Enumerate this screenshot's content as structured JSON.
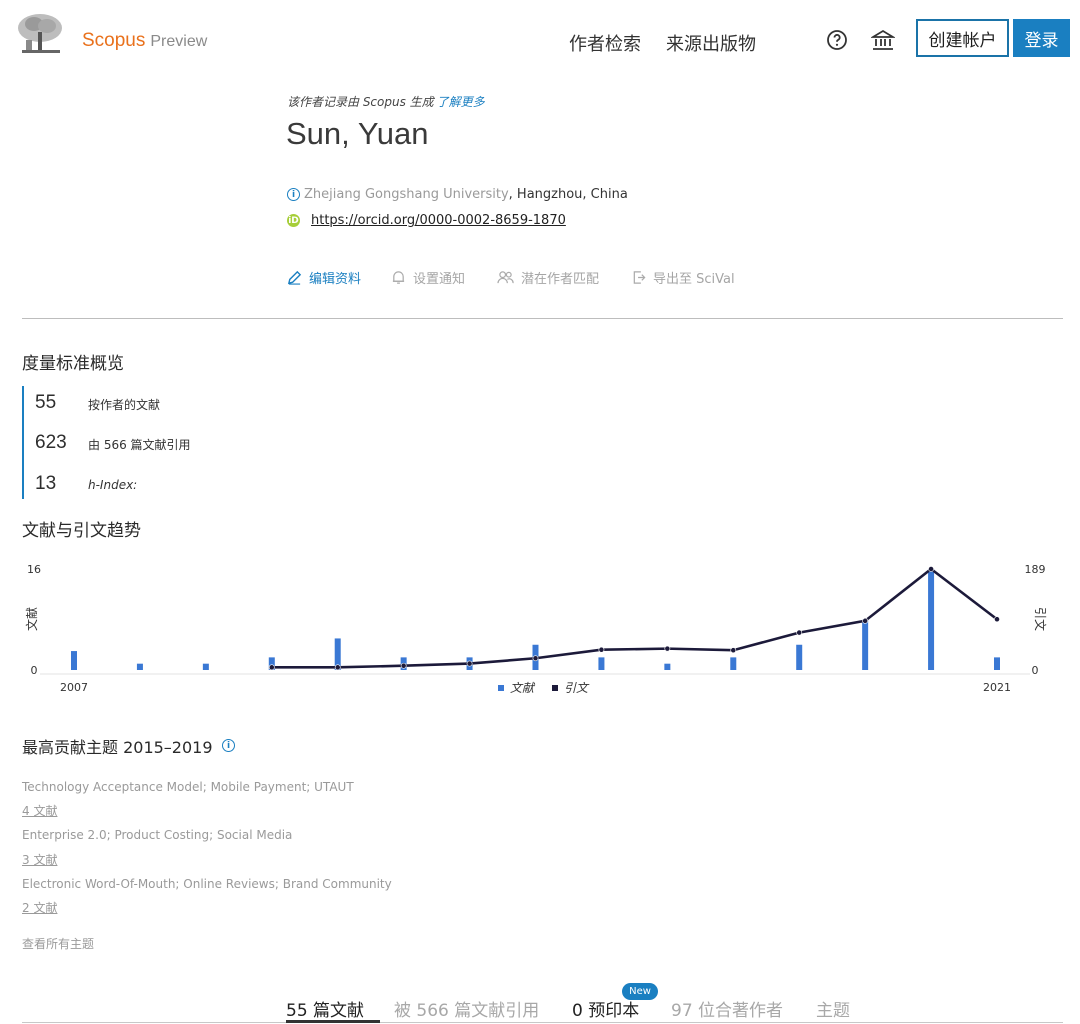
{
  "header": {
    "brand": "Scopus",
    "brand_suffix": "Preview",
    "nav": [
      "作者检索",
      "来源出版物"
    ],
    "create_account": "创建帐户",
    "login": "登录"
  },
  "profile": {
    "generated_note": "该作者记录由 Scopus 生成",
    "learn_more": "了解更多",
    "name": "Sun, Yuan",
    "affiliation": "Zhejiang Gongshang University",
    "location": ", Hangzhou, China",
    "orcid": "https://orcid.org/0000-0002-8659-1870",
    "actions": [
      "编辑资料",
      "设置通知",
      "潜在作者匹配",
      "导出至 SciVal"
    ]
  },
  "metrics": {
    "title": "度量标准概览",
    "items": [
      {
        "value": "55",
        "label": "按作者的文献"
      },
      {
        "value": "623",
        "label": "由 566 篇文献引用"
      },
      {
        "value": "13",
        "label": "h-Index:"
      }
    ]
  },
  "trends": {
    "title": "文献与引文趋势"
  },
  "chart_data": {
    "type": "bar",
    "x": [
      2007,
      2008,
      2009,
      2010,
      2011,
      2012,
      2013,
      2014,
      2015,
      2016,
      2017,
      2018,
      2019,
      2020,
      2021
    ],
    "series": [
      {
        "name": "文献",
        "type": "bar",
        "axis": "left",
        "color": "#3a78d4",
        "values": [
          3,
          1,
          1,
          2,
          5,
          2,
          2,
          4,
          2,
          1,
          2,
          4,
          8,
          16,
          2
        ]
      },
      {
        "name": "引文",
        "type": "line",
        "axis": "right",
        "color": "#1c1a3a",
        "values": [
          null,
          null,
          null,
          5,
          5,
          8,
          12,
          22,
          38,
          40,
          37,
          70,
          92,
          189,
          95
        ]
      }
    ],
    "y_left": {
      "label": "文献",
      "min": 0,
      "max": 16
    },
    "y_right": {
      "label": "引文",
      "min": 0,
      "max": 189
    },
    "x_tick_labels": [
      "2007",
      "2021"
    ],
    "left_tick_labels": [
      "16",
      "0"
    ],
    "right_tick_labels": [
      "189",
      "0"
    ],
    "legend_position": "bottom"
  },
  "topics": {
    "title": "最高贡献主题 2015–2019",
    "items": [
      {
        "name": "Technology Acceptance Model; Mobile Payment; UTAUT",
        "count": "4 文献"
      },
      {
        "name": "Enterprise 2.0; Product Costing; Social Media",
        "count": "3 文献"
      },
      {
        "name": "Electronic Word-Of-Mouth; Online Reviews; Brand Community",
        "count": "2 文献"
      }
    ],
    "view_all": "查看所有主题"
  },
  "tabs": {
    "items": [
      "55 篇文献",
      "被 566 篇文献引用",
      "0 预印本",
      "97 位合著作者",
      "主题"
    ],
    "new_badge": "New"
  },
  "colors": {
    "accent": "#1a7fc1",
    "brand": "#e9711c",
    "orcid": "#a6ce39"
  }
}
